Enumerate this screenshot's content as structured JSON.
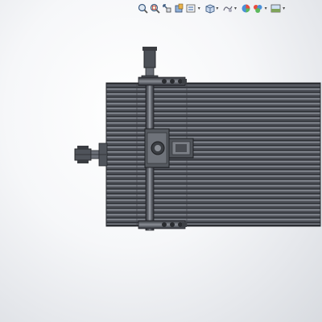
{
  "toolbar": {
    "buttons": [
      {
        "icon": "zoom-to-fit-icon"
      },
      {
        "icon": "zoom-to-area-icon"
      },
      {
        "icon": "previous-view-icon"
      },
      {
        "icon": "section-view-icon"
      },
      {
        "icon": "dynamic-annotation-views-icon",
        "has_dropdown": true
      },
      {
        "icon": "view-orientation-icon",
        "has_dropdown": true
      },
      {
        "icon": "display-style-icon",
        "has_dropdown": true
      },
      {
        "icon": "hide-show-items-icon"
      },
      {
        "icon": "edit-appearance-icon",
        "has_dropdown": true
      },
      {
        "icon": "apply-scene-icon",
        "has_dropdown": true
      },
      {
        "icon": "view-settings-icon",
        "has_dropdown": true
      }
    ]
  },
  "model": {
    "description_icon": "cnc-frame-assembly",
    "colors": {
      "frame": "#4a4d54",
      "rail_dark": "#2e3036",
      "rail_light": "#7a7e87",
      "motor": "#5a5e66"
    }
  }
}
